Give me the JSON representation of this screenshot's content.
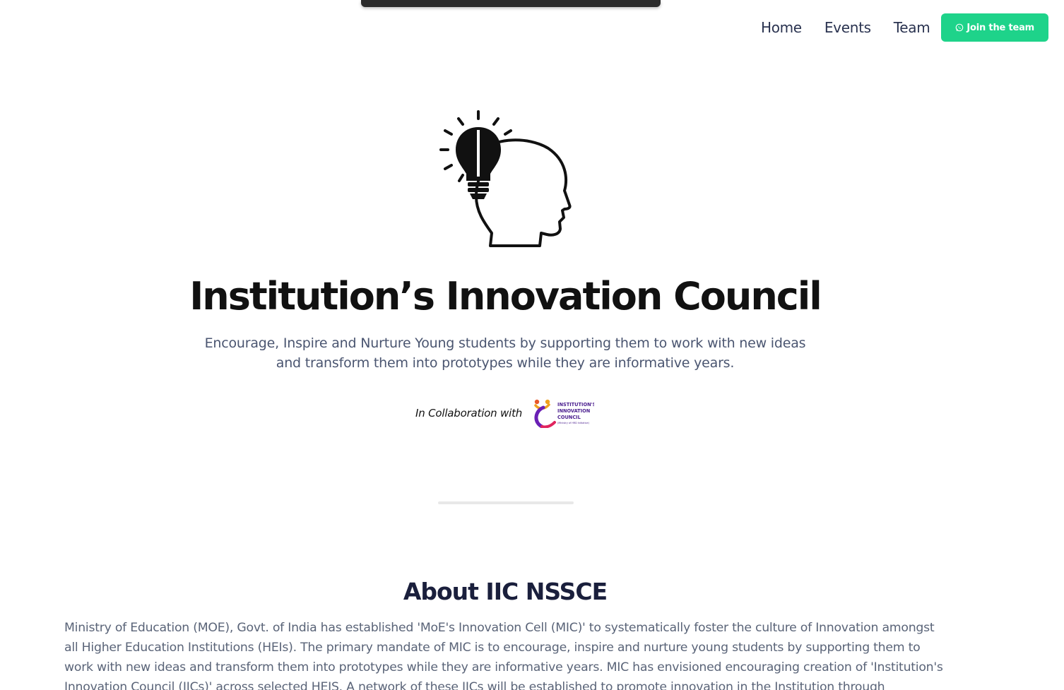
{
  "nav": {
    "items": [
      {
        "label": "Home"
      },
      {
        "label": "Events"
      },
      {
        "label": "Team"
      }
    ],
    "cta_label": "Join the team",
    "cta_icon": "whatsapp-icon",
    "cta_color": "#1ed38a"
  },
  "hero": {
    "icon": "head-lightbulb-icon",
    "title": "Institution’s Innovation Council",
    "subtitle": "Encourage, Inspire and Nurture Young students by supporting them to work with new ideas and transform them into prototypes while they are informative years.",
    "collab_text": "In Collaboration with",
    "collab_logo": {
      "name": "iic-logo",
      "lines": [
        "INSTITUTION'S",
        "INNOVATION",
        "COUNCIL",
        "(Ministry of HRD Initiative)"
      ]
    }
  },
  "about": {
    "title": "About IIC NSSCE",
    "text": "Ministry of Education (MOE), Govt. of India has established 'MoE's Innovation Cell (MIC)' to systematically foster the culture of Innovation amongst all Higher Education Institutions (HEIs). The primary mandate of MIC is to encourage, inspire and nurture young students by supporting them to work with new ideas and transform them into prototypes while they are informative years. MIC has envisioned encouraging creation of 'Institution's Innovation Council (IICs)' across selected HEIS. A network of these IICs will be established to promote innovation in the Institution through multitudinous modes leading to an"
  }
}
